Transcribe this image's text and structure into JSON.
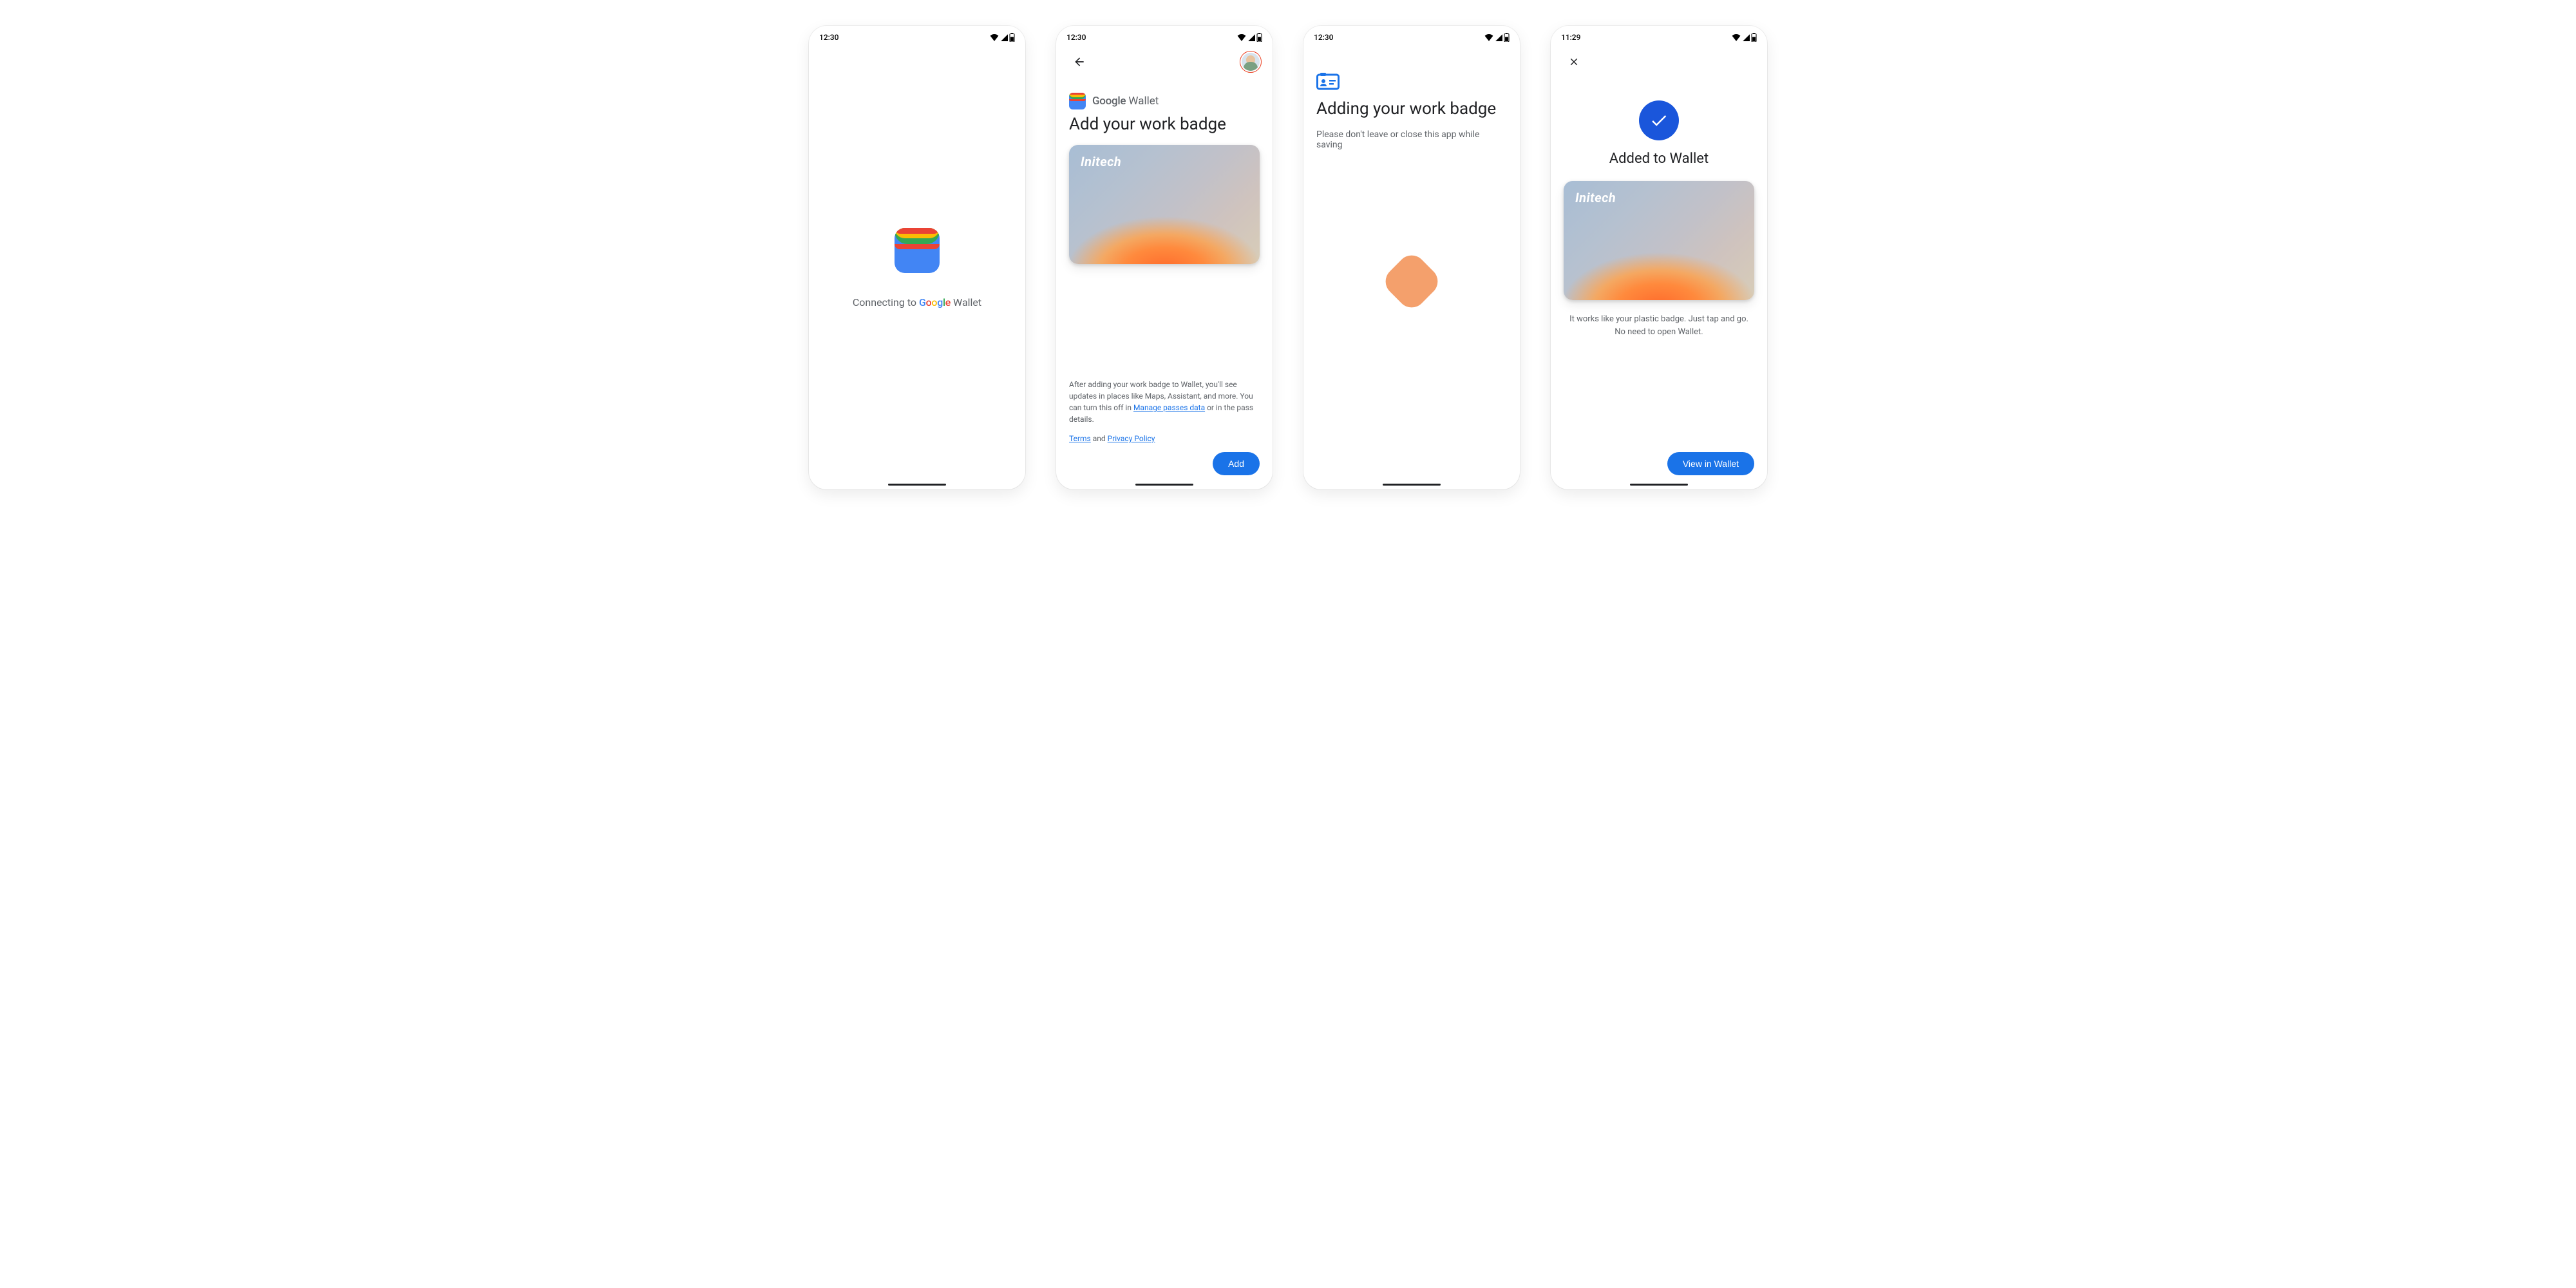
{
  "status": {
    "time_a": "12:30",
    "time_b": "12:30",
    "time_c": "12:30",
    "time_d": "11:29"
  },
  "screen1": {
    "connecting_prefix": "Connecting to ",
    "wallet_word": " Wallet"
  },
  "screen2": {
    "brand_wallet": " Wallet",
    "title": "Add your work badge",
    "badge_brand": "Initech",
    "disclaimer_1": "After adding your work badge to Wallet, you'll see updates in places like Maps, Assistant, and more. You can turn this off in ",
    "manage_link": "Manage passes data",
    "disclaimer_2": " or in the pass details.",
    "terms": "Terms",
    "and": " and ",
    "privacy": "Privacy Policy",
    "add_button": "Add"
  },
  "screen3": {
    "title": "Adding your work badge",
    "subtitle": "Please don't leave or close this app while saving"
  },
  "screen4": {
    "title": "Added to Wallet",
    "badge_brand": "Initech",
    "desc": "It works like your plastic badge. Just tap and go. No need to open Wallet.",
    "button": "View in Wallet"
  }
}
